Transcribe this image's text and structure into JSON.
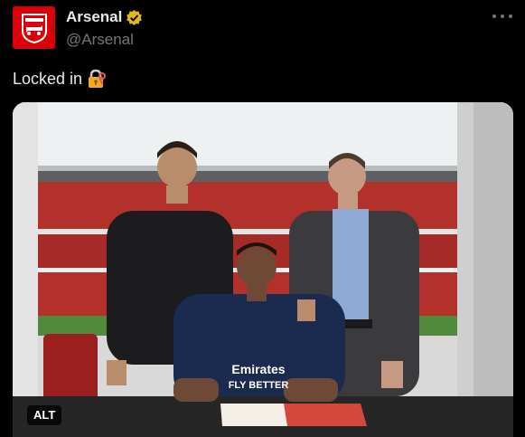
{
  "tweet": {
    "author": {
      "display_name": "Arsenal",
      "handle": "@Arsenal",
      "verified": true,
      "avatar_icon": "arsenal-crest-icon",
      "avatar_color": "#db0007",
      "verified_color": "#e2b719"
    },
    "text": "Locked in",
    "emoji": "lock-with-key-icon",
    "more_icon": "more-options-icon"
  },
  "media": {
    "alt_label": "ALT",
    "shirt_text_line1": "Emirates",
    "shirt_text_line2": "FLY BETTER"
  }
}
